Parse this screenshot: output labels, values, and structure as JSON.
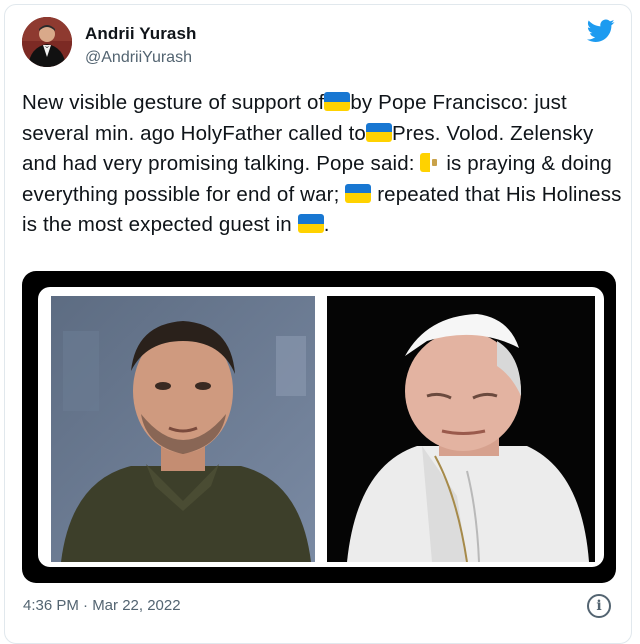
{
  "author": {
    "name": "Andrii Yurash",
    "handle": "@AndriiYurash"
  },
  "icons": {
    "twitter": "twitter-bird-icon",
    "info": "info-icon",
    "flag": "ukraine-flag-emoji",
    "vatican": "vatican-flag-emoji"
  },
  "tweet": {
    "seg1": "New visible gesture of support of",
    "seg2": "by Pope Francisco: just several min. ago HolyFather called to",
    "seg3": "Pres. Volod. Zelensky and had very promising talking. Pope said:",
    "seg4": "is praying & doing everything possible for end of war;",
    "seg5": "repeated that His Holiness is the most expected guest in",
    "seg6": "."
  },
  "timestamp": "4:36 PM · Mar 22, 2022",
  "colors": {
    "twitter_blue": "#1d9bf0",
    "text": "#0f1419",
    "secondary": "#536471",
    "flag_blue": "#1877d2",
    "flag_yellow": "#ffd200"
  }
}
